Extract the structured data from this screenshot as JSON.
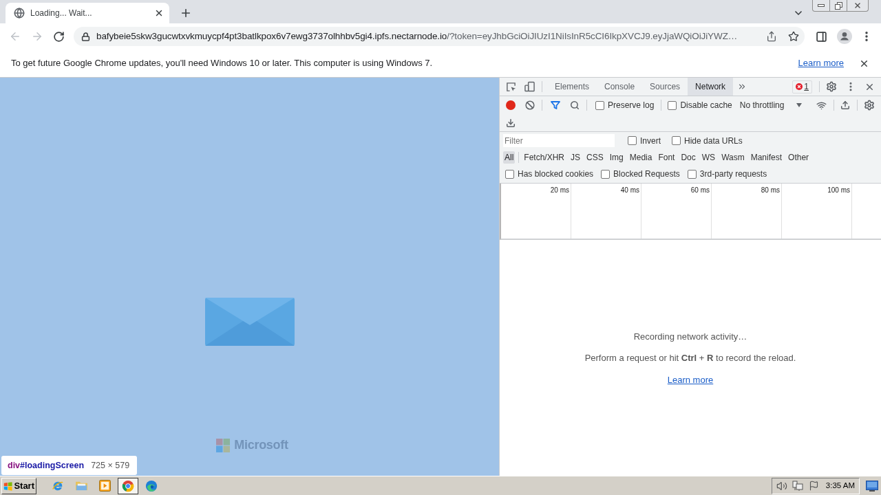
{
  "browser": {
    "tabs": [
      {
        "title": "Loading... Wait...",
        "selected": true
      }
    ],
    "address": {
      "host": "bafybeie5skw3gucwtxvkmuycpf4pt3batlkpox6v7ewg3737olhhbv5gi4.ipfs.nectarnode.io",
      "path": "/?token=eyJhbGciOiJIUzI1NiIsInR5cCI6IkpXVCJ9.eyJjaWQiOiJiYWZ…"
    },
    "infobar": {
      "message": "To get future Google Chrome updates, you'll need Windows 10 or later. This computer is using Windows 7.",
      "link": "Learn more"
    }
  },
  "page": {
    "brand": "Microsoft",
    "inspect_tooltip": {
      "tag": "div",
      "id": "#loadingScreen",
      "size": "725 × 579"
    }
  },
  "devtools": {
    "tabs": [
      {
        "label": "Elements",
        "selected": false
      },
      {
        "label": "Console",
        "selected": false
      },
      {
        "label": "Sources",
        "selected": false
      },
      {
        "label": "Network",
        "selected": true
      }
    ],
    "error_count": "1",
    "network": {
      "recording": true,
      "options": [
        {
          "label": "Preserve log",
          "checked": false
        },
        {
          "label": "Disable cache",
          "checked": false
        }
      ],
      "throttling": "No throttling",
      "filter": {
        "placeholder": "Filter"
      },
      "filter_options": [
        {
          "label": "Invert",
          "checked": false
        },
        {
          "label": "Hide data URLs",
          "checked": false
        }
      ],
      "type_filters": [
        {
          "label": "All",
          "selected": true
        },
        {
          "label": "Fetch/XHR",
          "selected": false
        },
        {
          "label": "JS",
          "selected": false
        },
        {
          "label": "CSS",
          "selected": false
        },
        {
          "label": "Img",
          "selected": false
        },
        {
          "label": "Media",
          "selected": false
        },
        {
          "label": "Font",
          "selected": false
        },
        {
          "label": "Doc",
          "selected": false
        },
        {
          "label": "WS",
          "selected": false
        },
        {
          "label": "Wasm",
          "selected": false
        },
        {
          "label": "Manifest",
          "selected": false
        },
        {
          "label": "Other",
          "selected": false
        }
      ],
      "request_filters": [
        {
          "label": "Has blocked cookies",
          "checked": false
        },
        {
          "label": "Blocked Requests",
          "checked": false
        },
        {
          "label": "3rd-party requests",
          "checked": false
        }
      ],
      "timeline_ticks": [
        "20 ms",
        "40 ms",
        "60 ms",
        "80 ms",
        "100 ms"
      ],
      "empty_state": {
        "title": "Recording network activity…",
        "hint": "Perform a request or hit **Ctrl** + **R** to record the reload.",
        "link": "Learn more"
      }
    }
  },
  "taskbar": {
    "start": "Start",
    "apps": [
      {
        "kind": "ie",
        "selected": false
      },
      {
        "kind": "explorer",
        "selected": false
      },
      {
        "kind": "media",
        "selected": false
      },
      {
        "kind": "chrome",
        "selected": true
      },
      {
        "kind": "edge",
        "selected": false
      }
    ],
    "clock": "3:35 AM"
  }
}
